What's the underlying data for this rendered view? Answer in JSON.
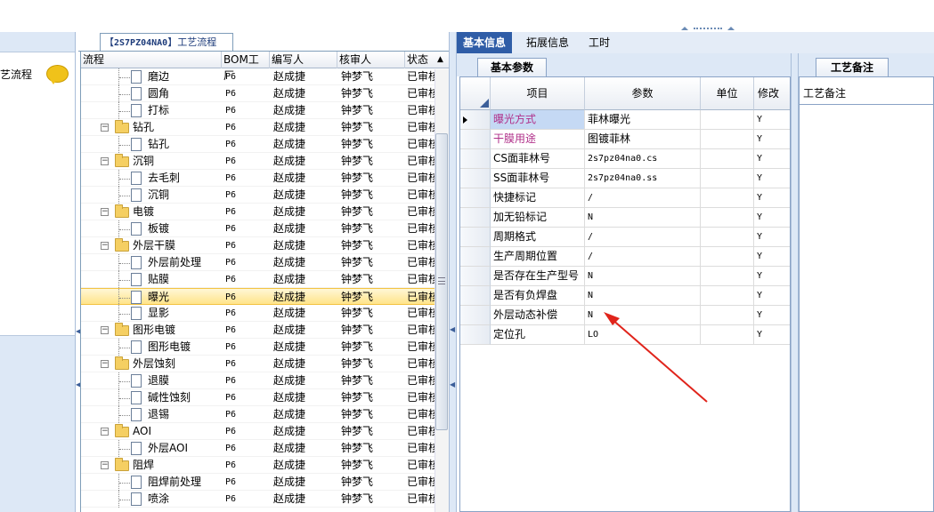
{
  "left_panel": {
    "title": "艺流程"
  },
  "tree_tab": {
    "prefix": "【",
    "code": "2S7PZ04NA0",
    "suffix": "】工艺流程"
  },
  "tree_columns": [
    "流程",
    "BOM工厂",
    "编写人",
    "核审人",
    "状态"
  ],
  "tree_rows": [
    {
      "name": "磨边",
      "level": 2,
      "kind": "doc",
      "bom": "P6",
      "writer": "赵成捷",
      "reviewer": "钟梦飞",
      "status": "已审核"
    },
    {
      "name": "圆角",
      "level": 2,
      "kind": "doc",
      "bom": "P6",
      "writer": "赵成捷",
      "reviewer": "钟梦飞",
      "status": "已审核"
    },
    {
      "name": "打标",
      "level": 2,
      "kind": "doc",
      "bom": "P6",
      "writer": "赵成捷",
      "reviewer": "钟梦飞",
      "status": "已审核"
    },
    {
      "name": "钻孔",
      "level": 1,
      "kind": "folder",
      "bom": "P6",
      "writer": "赵成捷",
      "reviewer": "钟梦飞",
      "status": "已审核"
    },
    {
      "name": "钻孔",
      "level": 2,
      "kind": "doc",
      "bom": "P6",
      "writer": "赵成捷",
      "reviewer": "钟梦飞",
      "status": "已审核"
    },
    {
      "name": "沉铜",
      "level": 1,
      "kind": "folder",
      "bom": "P6",
      "writer": "赵成捷",
      "reviewer": "钟梦飞",
      "status": "已审核"
    },
    {
      "name": "去毛刺",
      "level": 2,
      "kind": "doc",
      "bom": "P6",
      "writer": "赵成捷",
      "reviewer": "钟梦飞",
      "status": "已审核"
    },
    {
      "name": "沉铜",
      "level": 2,
      "kind": "doc",
      "bom": "P6",
      "writer": "赵成捷",
      "reviewer": "钟梦飞",
      "status": "已审核"
    },
    {
      "name": "电镀",
      "level": 1,
      "kind": "folder",
      "bom": "P6",
      "writer": "赵成捷",
      "reviewer": "钟梦飞",
      "status": "已审核"
    },
    {
      "name": "板镀",
      "level": 2,
      "kind": "doc",
      "bom": "P6",
      "writer": "赵成捷",
      "reviewer": "钟梦飞",
      "status": "已审核"
    },
    {
      "name": "外层干膜",
      "level": 1,
      "kind": "folder",
      "bom": "P6",
      "writer": "赵成捷",
      "reviewer": "钟梦飞",
      "status": "已审核"
    },
    {
      "name": "外层前处理",
      "level": 2,
      "kind": "doc",
      "bom": "P6",
      "writer": "赵成捷",
      "reviewer": "钟梦飞",
      "status": "已审核"
    },
    {
      "name": "贴膜",
      "level": 2,
      "kind": "doc",
      "bom": "P6",
      "writer": "赵成捷",
      "reviewer": "钟梦飞",
      "status": "已审核"
    },
    {
      "name": "曝光",
      "level": 2,
      "kind": "doc",
      "bom": "P6",
      "writer": "赵成捷",
      "reviewer": "钟梦飞",
      "status": "已审核",
      "selected": true
    },
    {
      "name": "显影",
      "level": 2,
      "kind": "doc",
      "bom": "P6",
      "writer": "赵成捷",
      "reviewer": "钟梦飞",
      "status": "已审核"
    },
    {
      "name": "图形电镀",
      "level": 1,
      "kind": "folder",
      "bom": "P6",
      "writer": "赵成捷",
      "reviewer": "钟梦飞",
      "status": "已审核"
    },
    {
      "name": "图形电镀",
      "level": 2,
      "kind": "doc",
      "bom": "P6",
      "writer": "赵成捷",
      "reviewer": "钟梦飞",
      "status": "已审核"
    },
    {
      "name": "外层蚀刻",
      "level": 1,
      "kind": "folder",
      "bom": "P6",
      "writer": "赵成捷",
      "reviewer": "钟梦飞",
      "status": "已审核"
    },
    {
      "name": "退膜",
      "level": 2,
      "kind": "doc",
      "bom": "P6",
      "writer": "赵成捷",
      "reviewer": "钟梦飞",
      "status": "已审核"
    },
    {
      "name": "碱性蚀刻",
      "level": 2,
      "kind": "doc",
      "bom": "P6",
      "writer": "赵成捷",
      "reviewer": "钟梦飞",
      "status": "已审核"
    },
    {
      "name": "退锡",
      "level": 2,
      "kind": "doc",
      "bom": "P6",
      "writer": "赵成捷",
      "reviewer": "钟梦飞",
      "status": "已审核"
    },
    {
      "name": "AOI",
      "level": 1,
      "kind": "folder",
      "bom": "P6",
      "writer": "赵成捷",
      "reviewer": "钟梦飞",
      "status": "已审核"
    },
    {
      "name": "外层AOI",
      "level": 2,
      "kind": "doc",
      "bom": "P6",
      "writer": "赵成捷",
      "reviewer": "钟梦飞",
      "status": "已审核"
    },
    {
      "name": "阻焊",
      "level": 1,
      "kind": "folder",
      "bom": "P6",
      "writer": "赵成捷",
      "reviewer": "钟梦飞",
      "status": "已审核"
    },
    {
      "name": "阻焊前处理",
      "level": 2,
      "kind": "doc",
      "bom": "P6",
      "writer": "赵成捷",
      "reviewer": "钟梦飞",
      "status": "已审核"
    },
    {
      "name": "喷涂",
      "level": 2,
      "kind": "doc",
      "bom": "P6",
      "writer": "赵成捷",
      "reviewer": "钟梦飞",
      "status": "已审核"
    }
  ],
  "right_tabs": [
    "基本信息",
    "拓展信息",
    "工时"
  ],
  "sub_tab": "基本参数",
  "notes_tab": "工艺备注",
  "notes_label": "工艺备注",
  "param_columns": [
    "项目",
    "参数",
    "单位",
    "修改"
  ],
  "param_rows": [
    {
      "item": "曝光方式",
      "value": "菲林曝光",
      "unit": "",
      "edit": "Y",
      "highlight": true,
      "current": true
    },
    {
      "item": "干膜用途",
      "value": "图镀菲林",
      "unit": "",
      "edit": "Y",
      "highlight": true
    },
    {
      "item": "CS面菲林号",
      "value": "2s7pz04na0.cs",
      "unit": "",
      "edit": "Y"
    },
    {
      "item": "SS面菲林号",
      "value": "2s7pz04na0.ss",
      "unit": "",
      "edit": "Y"
    },
    {
      "item": "快捷标记",
      "value": "/",
      "unit": "",
      "edit": "Y"
    },
    {
      "item": "加无铅标记",
      "value": "N",
      "unit": "",
      "edit": "Y"
    },
    {
      "item": "周期格式",
      "value": "/",
      "unit": "",
      "edit": "Y"
    },
    {
      "item": "生产周期位置",
      "value": "/",
      "unit": "",
      "edit": "Y"
    },
    {
      "item": "是否存在生产型号",
      "value": "N",
      "unit": "",
      "edit": "Y"
    },
    {
      "item": "是否有负焊盘",
      "value": "N",
      "unit": "",
      "edit": "Y"
    },
    {
      "item": "外层动态补偿",
      "value": "N",
      "unit": "",
      "edit": "Y"
    },
    {
      "item": "定位孔",
      "value": "LO",
      "unit": "",
      "edit": "Y"
    }
  ],
  "colors": {
    "accent": "#2f5da7",
    "highlight_text": "#b0308a",
    "arrow": "#e0241b",
    "selection": "#ffe48a"
  }
}
